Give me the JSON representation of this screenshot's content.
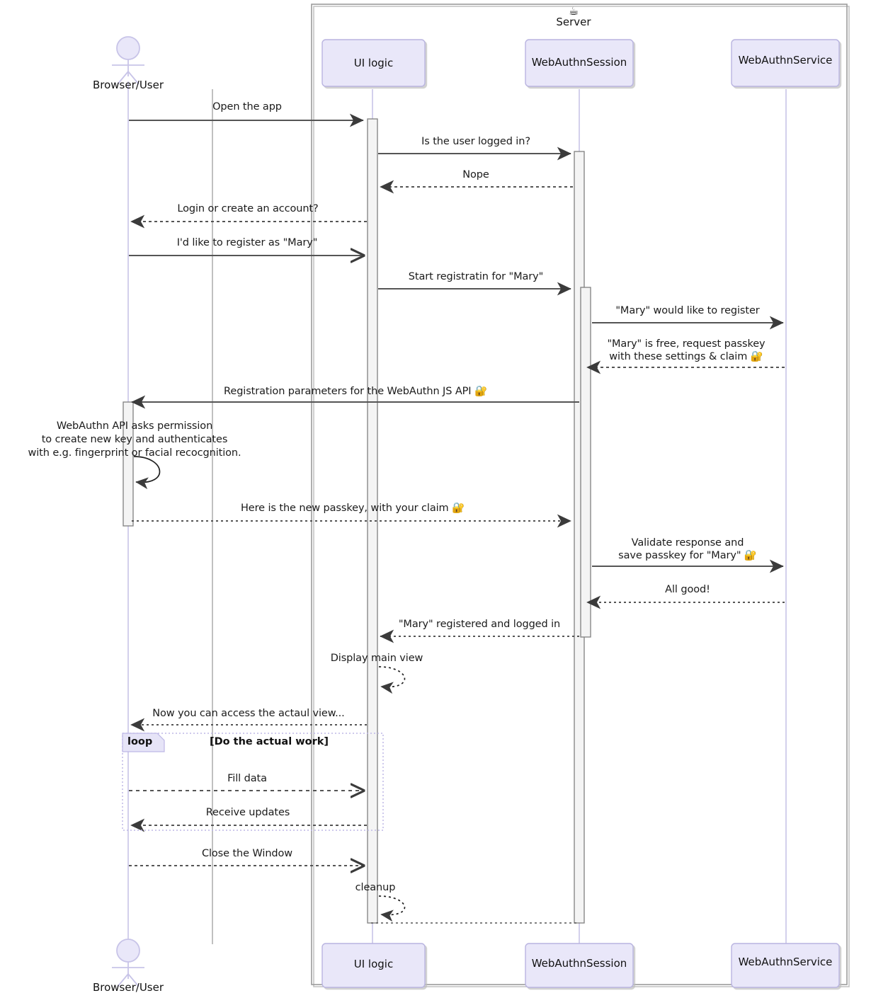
{
  "diagram": {
    "type": "uml-sequence-diagram",
    "title_icon": "coffee-cup-icon",
    "colors": {
      "participant_fill": "#e9e7f9",
      "participant_border": "#b9b4e0",
      "lifeline": "#c8c4e8",
      "activation_fill": "#f4f4f4",
      "activation_border": "#7f7f7f",
      "arrow": "#555555",
      "group_border": "#bdb7e6",
      "group_tab_fill": "#e6e4f7",
      "frame_border": "#9b9b9b",
      "text": "#1b1b1b"
    }
  },
  "group_box": {
    "label": "Server",
    "icon": "☕"
  },
  "actors": {
    "left": {
      "name": "Browser/User",
      "icon": "stick-figure-actor"
    }
  },
  "participants": [
    {
      "id": "ui",
      "label": "UI logic"
    },
    {
      "id": "session",
      "label": "WebAuthnSession"
    },
    {
      "id": "service",
      "label": "WebAuthnService"
    }
  ],
  "participants_bottom": [
    {
      "id": "ui",
      "label": "UI logic"
    },
    {
      "id": "session",
      "label": "WebAuthnSession"
    },
    {
      "id": "service",
      "label": "WebAuthnService"
    }
  ],
  "messages": [
    {
      "id": "m1",
      "text": "Open the app"
    },
    {
      "id": "m2",
      "text": "Is the user logged in?"
    },
    {
      "id": "m3",
      "text": "Nope"
    },
    {
      "id": "m4",
      "text": "Login or create an account?"
    },
    {
      "id": "m5",
      "text": "I'd like to register as \"Mary\""
    },
    {
      "id": "m6",
      "text": "Start registratin for \"Mary\""
    },
    {
      "id": "m7",
      "text": "\"Mary\" would like to register"
    },
    {
      "id": "m8a",
      "text": "\"Mary\" is free, request passkey"
    },
    {
      "id": "m8b",
      "text": "with these settings & claim 🔐"
    },
    {
      "id": "m9",
      "text": "Registration parameters for the WebAuthn JS API 🔐"
    },
    {
      "id": "n1a",
      "text": "WebAuthn API asks permission"
    },
    {
      "id": "n1b",
      "text": "to create new key and authenticates"
    },
    {
      "id": "n1c",
      "text": "with e.g. fingerprint or facial recocgnition."
    },
    {
      "id": "m10",
      "text": "Here is the new passkey, with your claim 🔐"
    },
    {
      "id": "m11a",
      "text": "Validate response and"
    },
    {
      "id": "m11b",
      "text": "save passkey for \"Mary\" 🔐"
    },
    {
      "id": "m12",
      "text": "All good!"
    },
    {
      "id": "m13",
      "text": "\"Mary\" registered and logged in"
    },
    {
      "id": "m14",
      "text": "Display main view"
    },
    {
      "id": "m15",
      "text": "Now you can access the actaul view..."
    },
    {
      "id": "m16",
      "text": "Fill data"
    },
    {
      "id": "m17",
      "text": "Receive updates"
    },
    {
      "id": "m18",
      "text": "Close the Window"
    },
    {
      "id": "m19",
      "text": "cleanup"
    }
  ],
  "loop_fragment": {
    "label": "loop",
    "condition": "[Do the actual work]"
  }
}
